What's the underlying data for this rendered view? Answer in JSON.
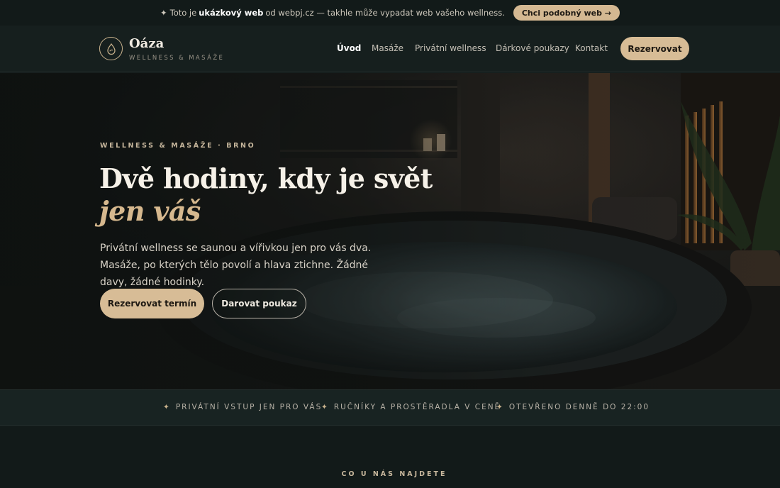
{
  "promo": {
    "sparkle": "✦",
    "text_before": "Toto je",
    "text_bold": "ukázkový web",
    "text_after": "od webpj.cz — takhle může vypadat web vašeho wellness.",
    "cta_label": "Chci podobný web →"
  },
  "header": {
    "logo_icon": "drop-icon",
    "brand": "Oáza",
    "tagline": "WELLNESS & MASÁŽE",
    "nav": [
      "Úvod",
      "Masáže",
      "Privátní wellness",
      "Dárkové poukazy",
      "Kontakt"
    ],
    "active_nav": "Úvod",
    "reserve_label": "Rezervovat"
  },
  "hero": {
    "eyebrow": "WELLNESS & MASÁŽE · BRNO",
    "title_line1": "Dvě hodiny, kdy je svět",
    "title_line2": "jen váš",
    "lead": "Privátní wellness se saunou a vířivkou jen pro vás dva. Masáže, po kterých tělo povolí a hlava ztichne. Žádné davy, žádné hodinky.",
    "primary_cta": "Rezervovat termín",
    "secondary_cta": "Darovat poukaz"
  },
  "features": {
    "icon": "✦",
    "items": [
      "PRIVÁTNÍ VSTUP JEN PRO VÁS",
      "RUČNÍKY A PROSTĚRADLA V CENĚ",
      "OTEVŘENO DENNĚ DO 22:00"
    ]
  },
  "next_section": {
    "eyebrow": "CO U NÁS NAJDETE"
  },
  "colors": {
    "background": "#121a19",
    "accent": "#d7bc96",
    "accent_text": "#d6b88e"
  }
}
